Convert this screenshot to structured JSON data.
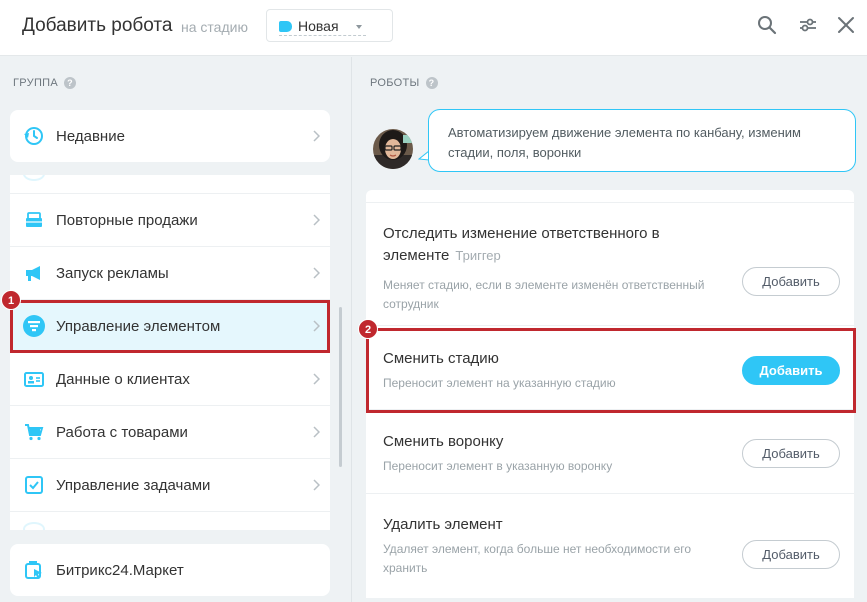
{
  "header": {
    "title": "Добавить робота",
    "subtitle": "на стадию",
    "stage": {
      "label": "Новая",
      "color": "#2fc6f6"
    },
    "icons": [
      "search-icon",
      "settings-sliders-icon",
      "close-icon"
    ]
  },
  "groups": {
    "heading": "ГРУППА",
    "recent": {
      "label": "Недавние",
      "icon": "history-icon"
    },
    "items": [
      {
        "label": "Повторные продажи",
        "icon": "repeat-sales-icon"
      },
      {
        "label": "Запуск рекламы",
        "icon": "megaphone-icon"
      },
      {
        "label": "Управление элементом",
        "icon": "funnel-icon",
        "active": true
      },
      {
        "label": "Данные о клиентах",
        "icon": "client-card-icon"
      },
      {
        "label": "Работа с товарами",
        "icon": "cart-icon"
      },
      {
        "label": "Управление задачами",
        "icon": "task-icon"
      }
    ],
    "market": {
      "label": "Битрикс24.Маркет",
      "icon": "market-icon"
    }
  },
  "robots": {
    "heading": "РОБОТЫ",
    "assistant_message": "Автоматизируем движение элемента по канбану, изменим стадии, поля, воронки",
    "items": [
      {
        "title": "Отследить изменение ответственного в элементе",
        "tag": "Триггер",
        "desc": "Меняет стадию, если в элементе изменён ответственный сотрудник",
        "button": "Добавить"
      },
      {
        "title": "Сменить стадию",
        "tag": "",
        "desc": "Переносит элемент на указанную стадию",
        "button": "Добавить",
        "highlighted": true
      },
      {
        "title": "Сменить воронку",
        "tag": "",
        "desc": "Переносит элемент в указанную воронку",
        "button": "Добавить"
      },
      {
        "title": "Удалить элемент",
        "tag": "",
        "desc": "Удаляет элемент, когда больше нет необходимости его хранить",
        "button": "Добавить"
      }
    ]
  },
  "callouts": {
    "first": "1",
    "second": "2",
    "color": "#c0282e"
  },
  "colors": {
    "accent": "#2fc6f6",
    "background": "#eef2f4"
  }
}
